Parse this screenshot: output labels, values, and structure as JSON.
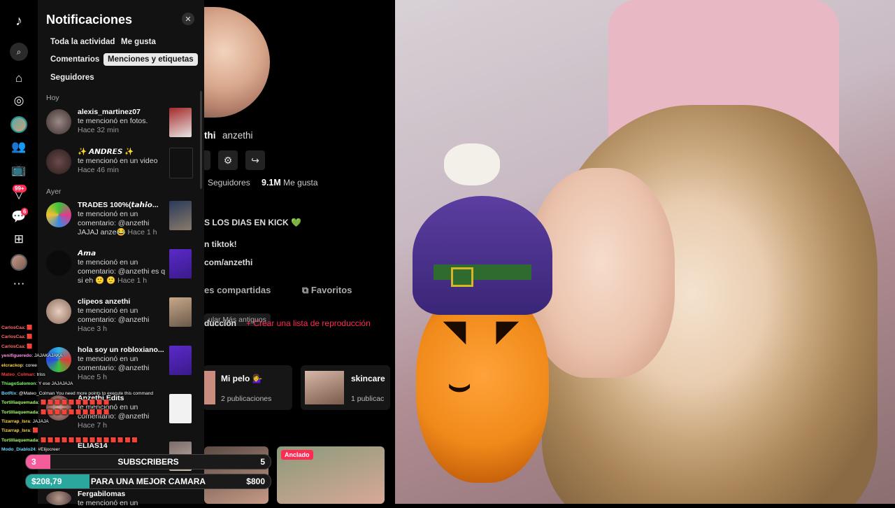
{
  "rail": {
    "badge_inbox": "99+",
    "badge_messages": "6"
  },
  "notifications": {
    "title": "Notificaciones",
    "close": "✕",
    "filters": [
      "Toda la actividad",
      "Me gusta",
      "Comentarios",
      "Menciones y etiquetas",
      "Seguidores"
    ],
    "active_filter": "Menciones y etiquetas",
    "sections": {
      "today": "Hoy",
      "yesterday": "Ayer"
    },
    "items": [
      {
        "user": "alexis_martinez07",
        "text": "te mencionó en fotos.",
        "time": "Hace 32 min"
      },
      {
        "user": "✨ 𝘼𝙉𝘿𝙍𝙀𝙎 ✨",
        "text": "te mencionó en un video",
        "time": "Hace 46 min"
      },
      {
        "user": "TRADES 100%(𝙩𝙖𝙝𝙞𝙤...",
        "text": "te mencionó en un comentario: @anzethi JAJAJ anze😂",
        "time": "Hace 1 h"
      },
      {
        "user": "𝘼𝙢𝙖",
        "text": "te mencionó en un comentario: @anzethi es q si eh 🙂 🙂",
        "time": "Hace 1 h"
      },
      {
        "user": "clipeos anzethi",
        "text": "te mencionó en un comentario: @anzethi",
        "time": "Hace 3 h"
      },
      {
        "user": "hola soy un robloxiano...",
        "text": "te mencionó en un comentario: @anzethi",
        "time": "Hace 5 h"
      },
      {
        "user": "Anzethi Edits",
        "text": "te mencionó en un comentario: @anzethi",
        "time": "Hace 7 h"
      },
      {
        "user": "ELIAS14",
        "text": "",
        "time": ""
      },
      {
        "user": "Fergabilomas",
        "text": "te mencionó en un",
        "time": ""
      }
    ]
  },
  "profile": {
    "name_fragment": "thi",
    "handle": "anzethi",
    "following_label": "Seguidores",
    "likes_count": "9.1M",
    "likes_label": "Me gusta",
    "bio_line1": "S LOS DIAS EN KICK 💚",
    "bio_line2": "n tiktok!",
    "bio_line3": "com/anzethi",
    "tab_shared": "es compartidas",
    "tab_favorites": "Favoritos",
    "sort_label": "ducción",
    "sort_chip": "ular   Más antiguos",
    "create_playlist": "+ Crear una lista de reproducción",
    "playlists": [
      {
        "title": "Mi pelo 💁‍♀️",
        "count": "2 publicaciones"
      },
      {
        "title": "skincare",
        "count": "1 publicac"
      }
    ],
    "pinned_label": "Anclado"
  },
  "chat": [
    {
      "user": "CarlosCaa",
      "msg": ": 🟥",
      "color": "#ff6b6b"
    },
    {
      "user": "CarlosCaa",
      "msg": ": 🟥",
      "color": "#ff6b6b"
    },
    {
      "user": "CarlosCaa",
      "msg": ": 🟥",
      "color": "#ff6b6b"
    },
    {
      "user": "yenifigueredo",
      "msg": ": JAJAKAJAKA",
      "color": "#ff8fe0"
    },
    {
      "user": "elcrackop",
      "msg": ": coree",
      "color": "#ffd54a"
    },
    {
      "user": "Mateo_Colman",
      "msg": ": triss",
      "color": "#ff3b3b"
    },
    {
      "user": "ThiagoSalomon",
      "msg": ": Y ese JAJAJAJA",
      "color": "#7cff6b"
    },
    {
      "user": "BotRix",
      "msg": ": @Mateo_Colman You need more points to execute this command",
      "color": "#6bd6ff"
    },
    {
      "user": "Tortilliaquemada",
      "msg": ": 🟥 🟥 🟥 🟥 🟥 🟥 🟥 🟥 🟥 🟥",
      "color": "#a7ff6b"
    },
    {
      "user": "Tortilliaquemada",
      "msg": ": 🟥 🟥 🟥 🟥 🟥 🟥 🟥 🟥 🟥 🟥",
      "color": "#a7ff6b"
    },
    {
      "user": "Tizarrap_Isra",
      "msg": ": JAJAJA",
      "color": "#ffd54a"
    },
    {
      "user": "Tizarrap_Isra",
      "msg": ": 🟥",
      "color": "#ffd54a"
    },
    {
      "user": "Tortilliaquemada",
      "msg": ": 🟥 🟥 🟥 🟥 🟥 🟥 🟥 🟥 🟥 🟥 🟥 🟥 🟥 🟥",
      "color": "#a7ff6b"
    },
    {
      "user": "Modo_Diablo24",
      "msg": ": #Elijocreer",
      "color": "#6bd6ff"
    }
  ],
  "goals": {
    "subs": {
      "current": "3",
      "label": "SUBSCRIBERS",
      "target": "5",
      "progress": 0.1
    },
    "money": {
      "current": "$208,79",
      "label": "PARA UNA MEJOR CAMARA",
      "target": "$800",
      "progress": 0.26
    }
  },
  "colors": {
    "accent": "#fe2c55",
    "sub_bar": "#f45c9c",
    "money_bar": "#2aa8a0"
  }
}
